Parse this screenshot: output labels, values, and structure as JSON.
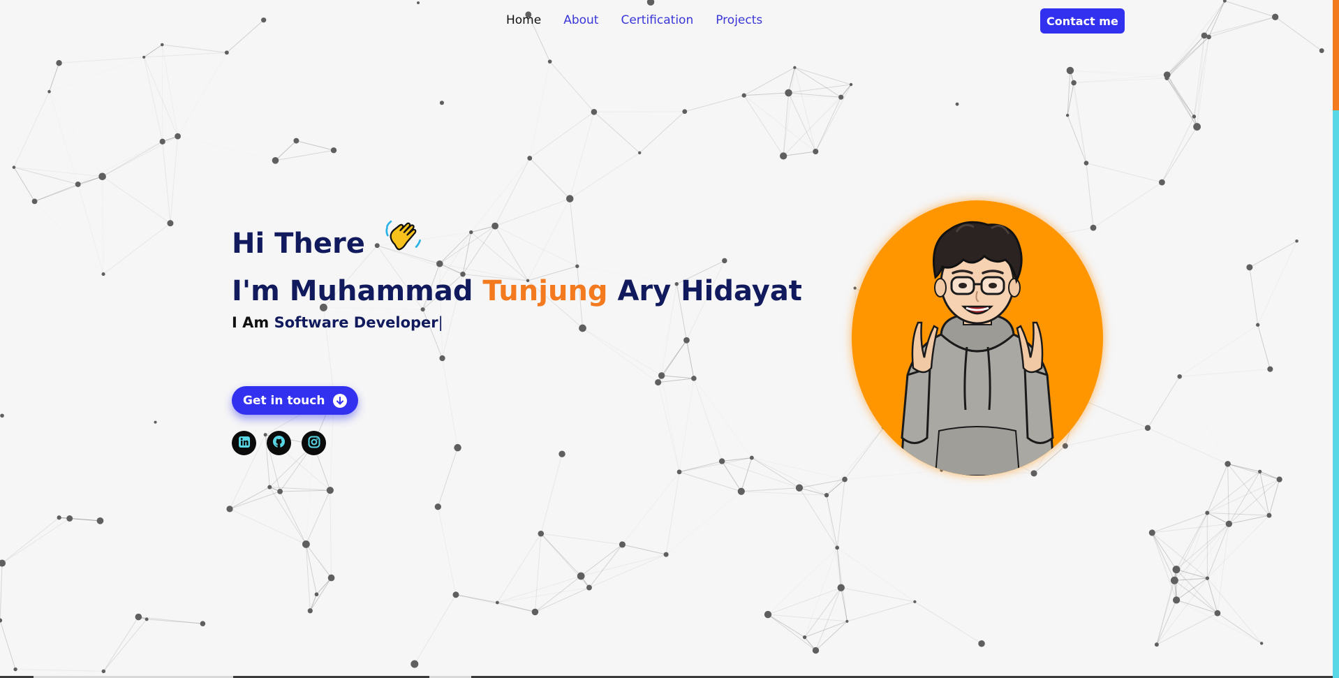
{
  "nav": {
    "links": [
      {
        "label": "Home",
        "active": true
      },
      {
        "label": "About",
        "active": false
      },
      {
        "label": "Certification",
        "active": false
      },
      {
        "label": "Projects",
        "active": false
      }
    ],
    "contact_label": "Contact me"
  },
  "hero": {
    "greeting": "Hi There",
    "greeting_icon": "waving-hand-icon",
    "name_prefix": "I'm Muhammad ",
    "name_accent": "Tunjung",
    "name_suffix": " Ary Hidayat",
    "subtitle_prefix": "I Am ",
    "subtitle_role": "Software Developer",
    "subtitle_caret": "|",
    "cta_label": "Get in touch",
    "cta_icon": "arrow-down-circle-icon"
  },
  "socials": [
    {
      "icon": "linkedin-icon"
    },
    {
      "icon": "github-icon"
    },
    {
      "icon": "instagram-icon"
    }
  ],
  "colors": {
    "background": "#f6f6f6",
    "primary": "#3331f0",
    "heading": "#101a5c",
    "accent": "#f37a1f",
    "avatar_bg": "#ff9600",
    "scroll_track": "#5ad7e6"
  }
}
